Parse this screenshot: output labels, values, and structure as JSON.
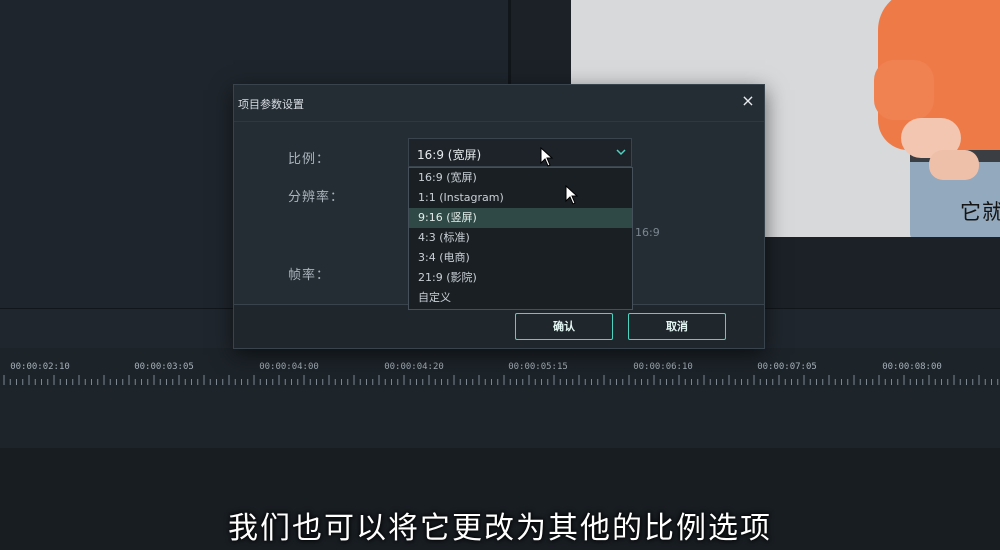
{
  "preview": {
    "subtitle_fragment": "它就"
  },
  "dialog": {
    "title": "项目参数设置",
    "close_glyph": "×",
    "fields": {
      "ratio_label": "比例：",
      "resolution_label": "分辨率：",
      "framerate_label": "帧率："
    },
    "ratio_select": {
      "value": "16:9 (宽屏)",
      "options": [
        "16:9 (宽屏)",
        "1:1 (Instagram)",
        "9:16 (竖屏)",
        "4:3 (标准)",
        "3:4 (电商)",
        "21:9 (影院)",
        "自定义"
      ],
      "highlighted": "9:16 (竖屏)"
    },
    "resolution_hint": "16:9",
    "confirm_label": "确认",
    "cancel_label": "取消"
  },
  "timeline": {
    "tick_labels": [
      "00:00:02:10",
      "00:00:03:05",
      "00:00:04:00",
      "00:00:04:20",
      "00:00:05:15",
      "00:00:06:10",
      "00:00:07:05",
      "00:00:08:00"
    ]
  },
  "video_subtitle": "我们也可以将它更改为其他的比例选项",
  "colors": {
    "accent": "#4fd2c0",
    "dialog_bg": "#252d34",
    "highlight_row": "#2f4a46"
  }
}
